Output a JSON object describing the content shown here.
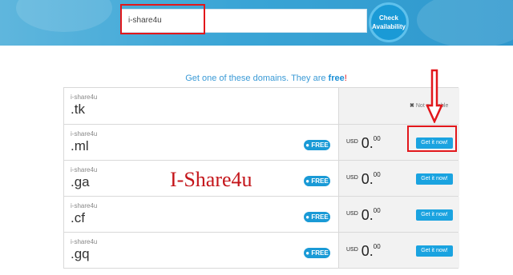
{
  "search": {
    "value": "i-share4u",
    "button_line1": "Check",
    "button_line2": "Availability"
  },
  "headline": {
    "lead": "Get one of these domains. They are ",
    "free": "free",
    "bang": "!"
  },
  "rows": [
    {
      "name": "i-share4u",
      "tld": ".tk",
      "available": false,
      "not_available_label": "Not available"
    },
    {
      "name": "i-share4u",
      "tld": ".ml",
      "badge": "FREE",
      "currency": "USD",
      "price_int": "0.",
      "price_dec": "00",
      "button": "Get it now!"
    },
    {
      "name": "i-share4u",
      "tld": ".ga",
      "badge": "FREE",
      "currency": "USD",
      "price_int": "0.",
      "price_dec": "00",
      "button": "Get it now!"
    },
    {
      "name": "i-share4u",
      "tld": ".cf",
      "badge": "FREE",
      "currency": "USD",
      "price_int": "0.",
      "price_dec": "00",
      "button": "Get it now!"
    },
    {
      "name": "i-share4u",
      "tld": ".gq",
      "badge": "FREE",
      "currency": "USD",
      "price_int": "0.",
      "price_dec": "00",
      "button": "Get it now!"
    }
  ],
  "watermark": "I-Share4u",
  "colors": {
    "accent": "#1a9ad6",
    "highlight": "#e2171b",
    "banner": "#3aa5d6"
  }
}
